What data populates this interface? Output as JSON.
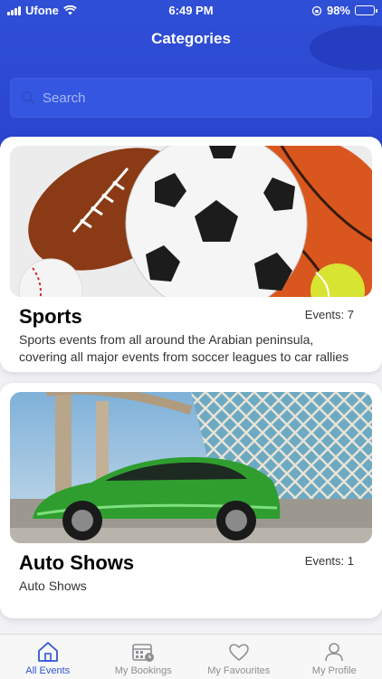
{
  "status_bar": {
    "carrier": "Ufone",
    "time": "6:49 PM",
    "battery": "98%"
  },
  "header": {
    "title": "Categories"
  },
  "search": {
    "placeholder": "Search"
  },
  "categories": [
    {
      "name": "Sports",
      "events_label": "Events: 7",
      "description": "Sports events from all around the Arabian peninsula, covering all major events from soccer leagues to car rallies"
    },
    {
      "name": "Auto Shows",
      "events_label": "Events: 1",
      "description": "Auto Shows"
    }
  ],
  "tabbar": {
    "items": [
      {
        "label": "All Events",
        "icon": "home-icon",
        "active": true
      },
      {
        "label": "My Bookings",
        "icon": "calendar-icon",
        "active": false
      },
      {
        "label": "My Favourites",
        "icon": "heart-icon",
        "active": false
      },
      {
        "label": "My Profile",
        "icon": "person-icon",
        "active": false
      }
    ]
  },
  "colors": {
    "primary": "#2f4fd6",
    "active_tab": "#2f55d4",
    "inactive_tab": "#8e8e93"
  }
}
